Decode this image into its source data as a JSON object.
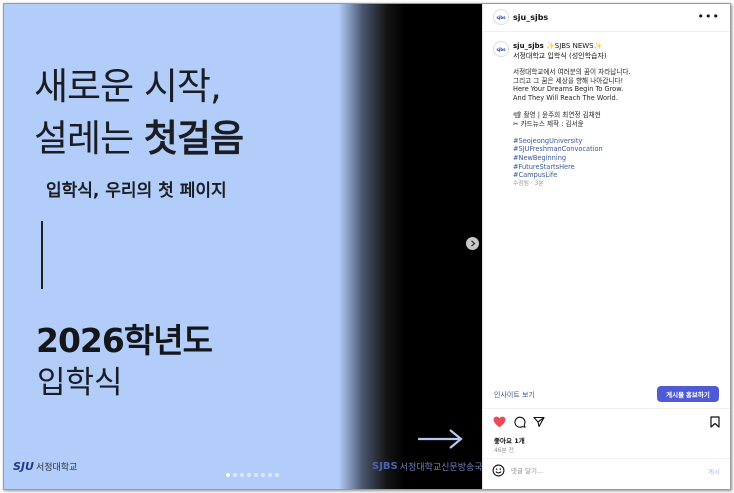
{
  "slide": {
    "headline_line1": "새로운 시작,",
    "headline_line2_regular": "설레는 ",
    "headline_line2_bold": "첫걸음",
    "subline": "입학식, 우리의 첫 페이지",
    "year": "2026학년도",
    "ceremony": "입학식",
    "logo_left_mark": "SJU",
    "logo_left_text": "서정대학교",
    "logo_right_mark": "SJBS",
    "logo_right_text": "서정대학교신문방송국",
    "carousel_total": 8,
    "carousel_active": 1
  },
  "header": {
    "username": "sju_sjbs",
    "avatar_text": "sjbs"
  },
  "caption": {
    "username": "sju_sjbs",
    "title": "✨SJBS NEWS✨",
    "subtitle": "서정대학교 입학식 (성인학습자)",
    "lines": [
      "서정대학교에서 여러분의 꿈이 자라납니다.",
      "그리고 그 꿈은 세상을 향해 나아갑니다!",
      "Here Your Dreams Begin To Grow.",
      "And They Will Reach The World."
    ],
    "credits": [
      "📽 촬영 | 윤주희 최연정 김채현",
      "✂ 카드뉴스 제작 : 김서윤"
    ],
    "hashtags": [
      "#SeojeongUniversity",
      "#SJUFreshmanConvocation",
      "#NewBeginning",
      "#FutureStartsHere",
      "#CampusLife"
    ],
    "meta": "수정됨 · 3분"
  },
  "actions": {
    "insights": "인사이트 보기",
    "promote": "게시물 홍보하기"
  },
  "engagement": {
    "likes": "좋아요 1개",
    "time": "46분 전"
  },
  "comment": {
    "placeholder": "댓글 달기...",
    "post": "게시"
  },
  "colors": {
    "slide_bg": "#b3cdfa",
    "promote_button": "#4f5bd5",
    "link": "#385898",
    "heart": "#ed4956"
  }
}
